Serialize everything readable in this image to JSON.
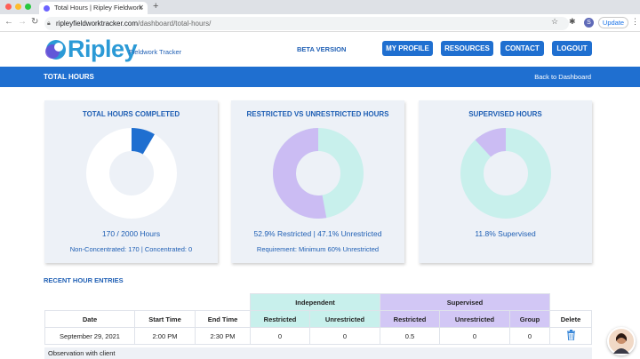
{
  "browser": {
    "tab_title": "Total Hours | Ripley Fieldwork",
    "url_domain": "ripleyfieldworktracker.com",
    "url_path": "/dashboard/total-hours/",
    "update_label": "Update",
    "profile_initial": "S"
  },
  "header": {
    "logo_text": "Ripley",
    "logo_sub": "Fieldwork Tracker",
    "beta": "BETA VERSION",
    "nav": {
      "profile": "MY PROFILE",
      "resources": "RESOURCES",
      "contact": "CONTACT",
      "logout": "LOGOUT"
    }
  },
  "bar": {
    "title": "TOTAL HOURS",
    "back": "Back to Dashboard"
  },
  "cards": {
    "total": {
      "title": "TOTAL HOURS COMPLETED",
      "line1": "170 / 2000 Hours",
      "line2": "Non-Concentrated: 170 | Concentrated: 0",
      "fraction": 0.085
    },
    "restricted": {
      "title": "RESTRICTED VS UNRESTRICTED HOURS",
      "line1": "52.9% Restricted | 47.1% Unrestricted",
      "line2": "Requirement: Minimum 60% Unrestricted",
      "restricted_fraction": 0.529
    },
    "supervised": {
      "title": "SUPERVISED HOURS",
      "line1": "11.8% Supervised",
      "supervised_fraction": 0.118
    }
  },
  "colors": {
    "blue": "#1f6fd0",
    "teal": "#c8f0ec",
    "purple": "#cbbcf3"
  },
  "recent": {
    "title": "RECENT HOUR ENTRIES",
    "group_independent": "Independent",
    "group_supervised": "Supervised",
    "headers": [
      "Date",
      "Start Time",
      "End Time",
      "Restricted",
      "Unrestricted",
      "Restricted",
      "Unrestricted",
      "Group",
      "Delete"
    ],
    "rows": [
      [
        "September 29, 2021",
        "2:00 PM",
        "2:30 PM",
        "0",
        "0",
        "0.5",
        "0",
        "0"
      ]
    ],
    "note": "Observation with client"
  }
}
